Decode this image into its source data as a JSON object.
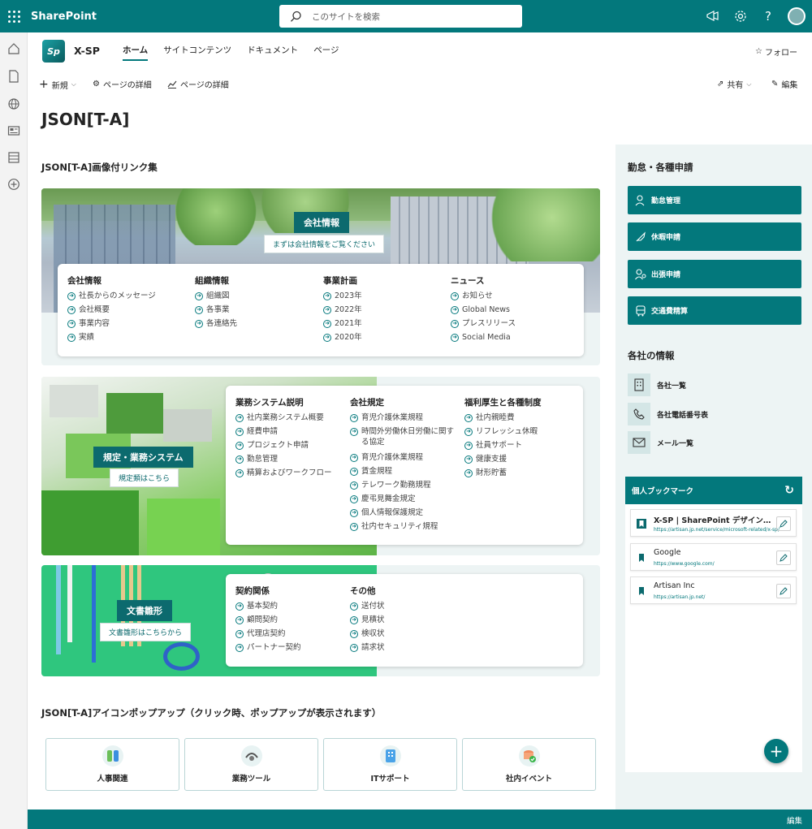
{
  "suite": {
    "brand": "SharePoint",
    "search_placeholder": "このサイトを検索"
  },
  "site": {
    "logo_text": "Sp",
    "name": "X-SP",
    "nav": [
      {
        "label": "ホーム"
      },
      {
        "label": "サイトコンテンツ"
      },
      {
        "label": "ドキュメント"
      },
      {
        "label": "ページ"
      }
    ],
    "follow": "フォロー"
  },
  "commands": {
    "new": "新規",
    "page_details": "ページの詳細",
    "page_analytics": "ページの詳細",
    "share": "共有",
    "edit": "編集"
  },
  "page_title": "JSON[T-A]",
  "links_section": {
    "title": "JSON[T-A]画像付リンク集",
    "card1": {
      "label": "会社情報",
      "sub": "まずは会社情報をご覧ください",
      "columns": [
        {
          "heading": "会社情報",
          "items": [
            "社長からのメッセージ",
            "会社概要",
            "事業内容",
            "実績"
          ]
        },
        {
          "heading": "組織情報",
          "items": [
            "組織図",
            "各事業",
            "各連絡先"
          ]
        },
        {
          "heading": "事業計画",
          "items": [
            "2023年",
            "2022年",
            "2021年",
            "2020年"
          ]
        },
        {
          "heading": "ニュース",
          "items": [
            "お知らせ",
            "Global News",
            "プレスリリース",
            "Social Media"
          ]
        }
      ]
    },
    "card2": {
      "label": "規定・業務システム",
      "sub": "規定類はこちら",
      "columns": [
        {
          "heading": "業務システム説明",
          "items": [
            "社内業務システム概要",
            "経費申請",
            "プロジェクト申請",
            "勤怠管理",
            "精算およびワークフロー"
          ]
        },
        {
          "heading": "会社規定",
          "items": [
            "育児介護休業規程",
            "時間外労働休日労働に関する協定",
            "育児介護休業規程",
            "賃金規程",
            "テレワーク勤務規程",
            "慶弔見舞金規定",
            "個人情報保護規定",
            "社内セキュリティ規程"
          ]
        },
        {
          "heading": "福利厚生と各種制度",
          "items": [
            "社内親睦費",
            "リフレッシュ休暇",
            "社員サポート",
            "健康支援",
            "財形貯蓄"
          ]
        }
      ]
    },
    "card3": {
      "label": "文書雛形",
      "sub": "文書雛形はこちらから",
      "columns": [
        {
          "heading": "契約関係",
          "items": [
            "基本契約",
            "顧問契約",
            "代理店契約",
            "パートナー契約"
          ]
        },
        {
          "heading": "その他",
          "items": [
            "送付状",
            "見積状",
            "検収状",
            "請求状"
          ]
        }
      ]
    }
  },
  "popup_section": {
    "title": "JSON[T-A]アイコンポップアップ（クリック時、ポップアップが表示されます）",
    "cards": [
      {
        "label": "人事関連",
        "icon": "people-icon"
      },
      {
        "label": "業務ツール",
        "icon": "tools-icon"
      },
      {
        "label": "ITサポート",
        "icon": "building-icon"
      },
      {
        "label": "社内イベント",
        "icon": "event-icon"
      }
    ]
  },
  "right": {
    "apply_title": "勤怠・各種申請",
    "apply_buttons": [
      {
        "label": "勤怠管理",
        "icon": "person-clock-icon"
      },
      {
        "label": "休暇申請",
        "icon": "rocket-icon"
      },
      {
        "label": "出張申請",
        "icon": "person-pin-icon"
      },
      {
        "label": "交通費精算",
        "icon": "bus-icon"
      }
    ],
    "company_title": "各社の情報",
    "company_links": [
      {
        "label": "各社一覧",
        "icon": "building-icon"
      },
      {
        "label": "各社電話番号表",
        "icon": "phone-icon"
      },
      {
        "label": "メール一覧",
        "icon": "mail-icon"
      }
    ],
    "bookmarks": {
      "title": "個人ブックマーク",
      "items": [
        {
          "title": "X-SP | SharePoint デザイン・機...",
          "url": "https://artisan.jp.net/service/microsoft-related/x-sp/"
        },
        {
          "title": "Google",
          "url": "https://www.google.com/"
        },
        {
          "title": "Artisan Inc",
          "url": "https://artisan.jp.net/"
        }
      ]
    }
  },
  "footer": {
    "edit": "編集"
  },
  "colors": {
    "theme": "#03787c",
    "theme_dark": "#0c6a6e",
    "panel_bg": "#edf4f4"
  }
}
